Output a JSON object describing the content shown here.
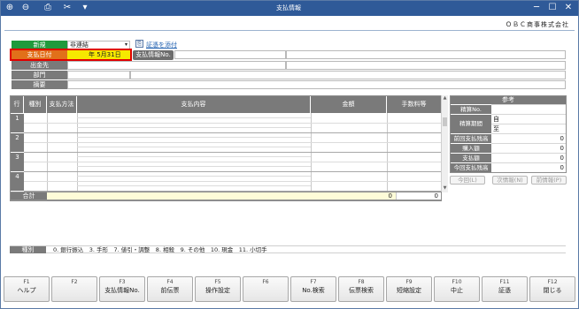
{
  "window": {
    "title": "支払情報",
    "company": "ＯＢＣ商事株式会社",
    "toolbar_icons": [
      "search-plus-icon",
      "search-minus-icon",
      "print-icon",
      "scissors-icon",
      "dropdown-icon"
    ]
  },
  "form": {
    "new_label": "新規",
    "kind_value": "非連結",
    "attach_link": "証憑を添付",
    "date_label": "支払日付",
    "date_value": "年  5月31日",
    "payinfo_button": "支払情報No.",
    "payee_label": "出金先",
    "dept_label": "部門",
    "memo_label": "摘要"
  },
  "grid": {
    "headers": [
      "行",
      "種別",
      "支払方法",
      "支払内容",
      "金額",
      "手数料等"
    ],
    "rows": [
      "1",
      "2",
      "3",
      "4"
    ],
    "total_label": "合計",
    "total_amount": "0",
    "total_fee": "0"
  },
  "reference": {
    "title": "参考",
    "rows": [
      {
        "label": "精算No.",
        "value": ""
      },
      {
        "label": "精算期間",
        "value": "自"
      },
      {
        "label": "",
        "value": "至"
      },
      {
        "label": "前回支払残高",
        "value": "0"
      },
      {
        "label": "購入額",
        "value": "0"
      },
      {
        "label": "支払額",
        "value": "0"
      },
      {
        "label": "今回支払残高",
        "value": "0"
      }
    ],
    "buttons": [
      "今回(L)",
      "次情報(N)",
      "前情報(P)"
    ]
  },
  "legend": {
    "label": "種別",
    "text": "0. 銀行振込　3. 手形　7. 値引・調整　8. 相殺　9. その他　10. 現金　11. 小切手"
  },
  "fkeys": [
    {
      "key": "F1",
      "label": "ヘルプ"
    },
    {
      "key": "F2",
      "label": ""
    },
    {
      "key": "F3",
      "label": "支払情報No."
    },
    {
      "key": "F4",
      "label": "前伝票"
    },
    {
      "key": "F5",
      "label": "操作設定"
    },
    {
      "key": "F6",
      "label": ""
    },
    {
      "key": "F7",
      "label": "No.検索"
    },
    {
      "key": "F8",
      "label": "伝票検索"
    },
    {
      "key": "F9",
      "label": "短縮設定"
    },
    {
      "key": "F10",
      "label": "中止"
    },
    {
      "key": "F11",
      "label": "証憑"
    },
    {
      "key": "F12",
      "label": "閉じる"
    }
  ]
}
